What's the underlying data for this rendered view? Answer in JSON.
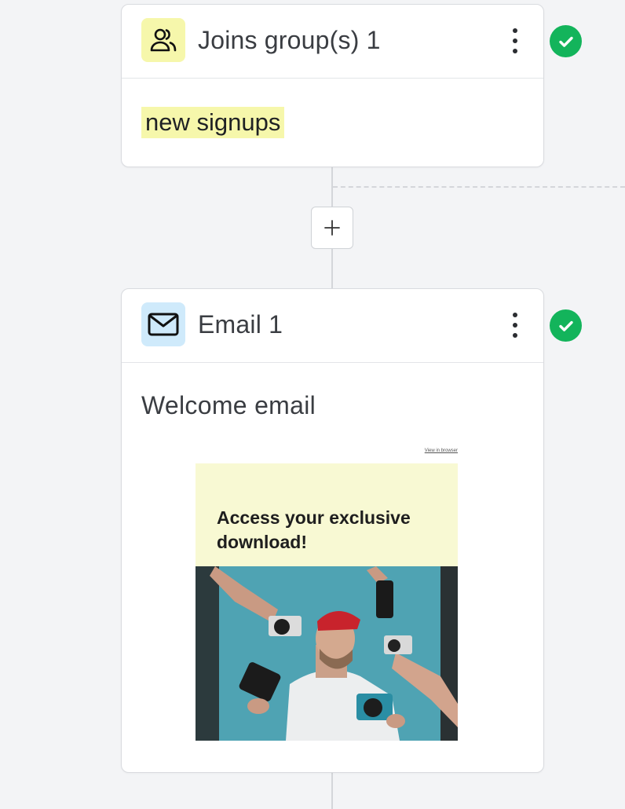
{
  "trigger_card": {
    "title": "Joins group(s) 1",
    "icon": "users-icon",
    "group_tag": "new signups",
    "status": "complete"
  },
  "add_step": {
    "icon": "plus-icon"
  },
  "email_card": {
    "title": "Email 1",
    "icon": "envelope-icon",
    "subject": "Welcome email",
    "status": "complete",
    "preview": {
      "view_in_browser": "View in browser",
      "headline": "Access your exclusive download!"
    }
  },
  "colors": {
    "background": "#f3f4f6",
    "trigger_icon_bg": "#f6f7ab",
    "email_icon_bg": "#cfeafb",
    "status_green": "#13b45b"
  }
}
